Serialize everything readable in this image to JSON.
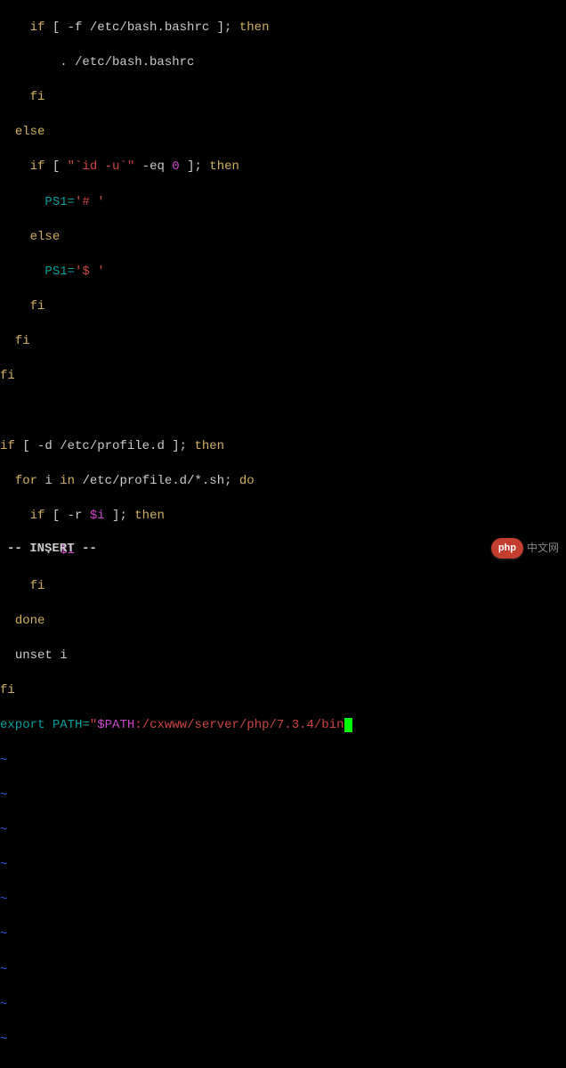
{
  "code": {
    "l1_if": "if",
    "l1_test": " [ -f /etc/bash.bashrc ]; ",
    "l1_then": "then",
    "l2_dot": ". /etc/bash.bashrc",
    "l3_fi": "fi",
    "l4_else": "else",
    "l5_if": "if",
    "l5_open": " [ ",
    "l5_str1": "\"`id -u`\"",
    "l5_eq": " -eq ",
    "l5_zero": "0",
    "l5_close": " ]; ",
    "l5_then": "then",
    "l6_ps1": "PS1=",
    "l6_val": "'# '",
    "l7_else": "else",
    "l8_ps1": "PS1=",
    "l8_val": "'$ '",
    "l9_fi": "fi",
    "l10_fi": "fi",
    "l11_fi": "fi",
    "l13_if": "if",
    "l13_test": " [ -d /etc/profile.d ]; ",
    "l13_then": "then",
    "l14_for": "for",
    "l14_var": " i ",
    "l14_in": "in",
    "l14_glob": " /etc/profile.d/*.sh; ",
    "l14_do": "do",
    "l15_if": "if",
    "l15_open": " [ -r ",
    "l15_var": "$i",
    "l15_close": " ]; ",
    "l15_then": "then",
    "l16_dot": ". ",
    "l16_var": "$i",
    "l17_fi": "fi",
    "l18_done": "done",
    "l19_unset": "unset",
    "l19_var": " i",
    "l20_fi": "fi",
    "l21_export": "export",
    "l21_path": " PATH=",
    "l21_q1": "\"",
    "l21_pathvar": "$PATH",
    "l21_rest": ":/cxwww/server/php/7.3.4/bin",
    "l21_q2": "\"",
    "tilde": "~"
  },
  "status": "-- INSERT --",
  "watermark": {
    "badge": "php",
    "text": "中文网"
  }
}
